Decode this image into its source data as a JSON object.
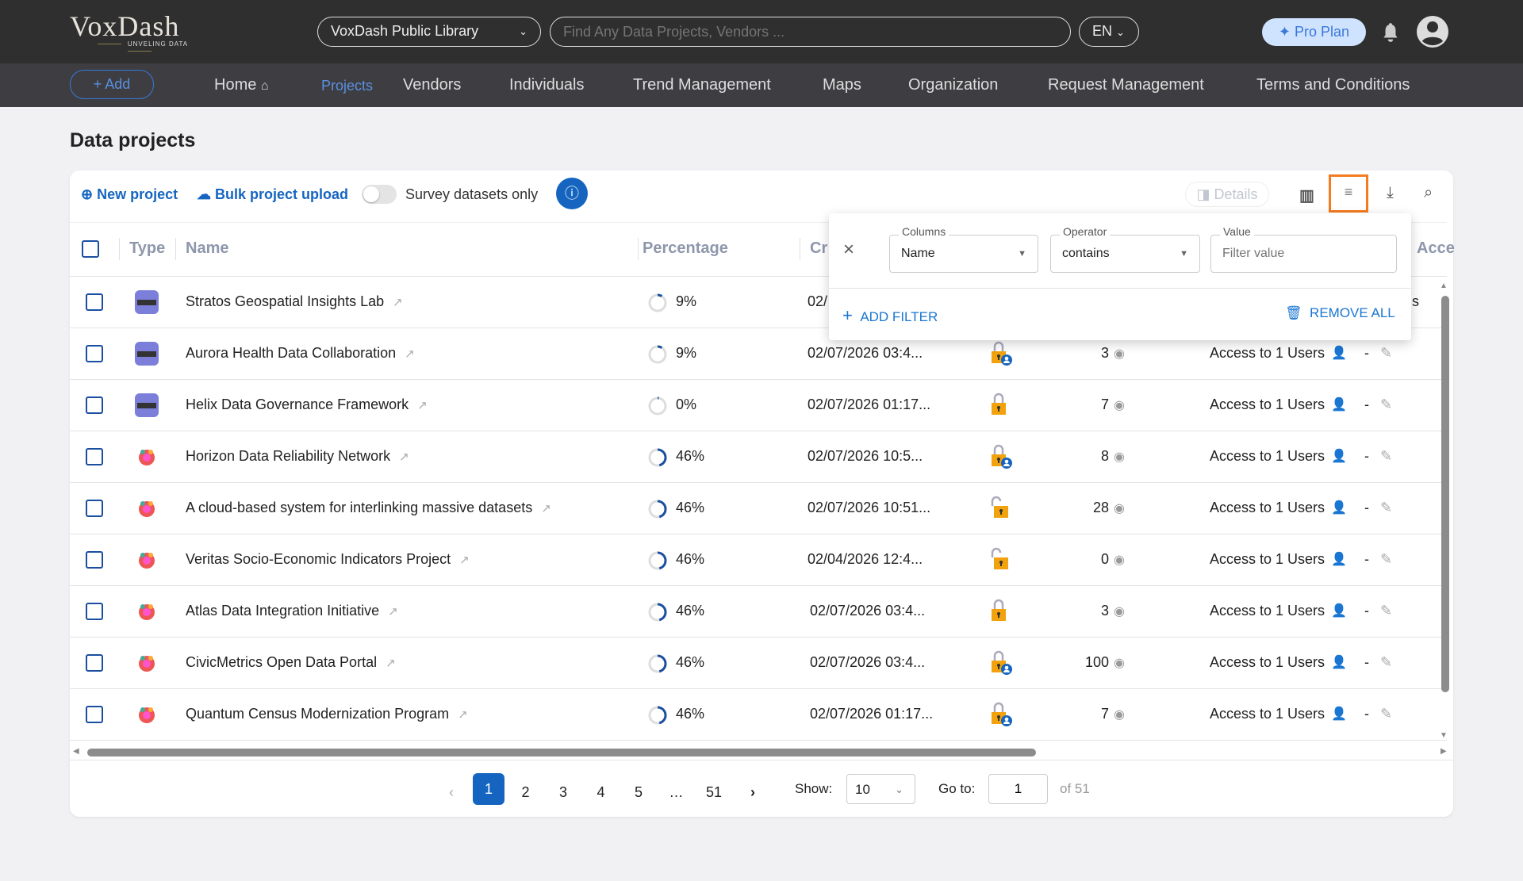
{
  "header": {
    "logo": "VoxDash",
    "tagline": "UNVELING DATA",
    "library": "VoxDash Public Library",
    "search_placeholder": "Find Any Data Projects, Vendors ...",
    "language": "EN",
    "plan": "Pro Plan"
  },
  "nav": {
    "add": "Add",
    "items": [
      "Home",
      "Projects",
      "Vendors",
      "Individuals",
      "Trend Management",
      "Maps",
      "Organization",
      "Request Management",
      "Terms and Conditions"
    ],
    "active": "Projects"
  },
  "page": {
    "title": "Data projects"
  },
  "toolbar": {
    "new_project": "New project",
    "bulk_upload": "Bulk project upload",
    "survey_only": "Survey datasets only",
    "details": "Details"
  },
  "table": {
    "headers": {
      "type": "Type",
      "name": "Name",
      "percentage": "Percentage",
      "created": "Cr",
      "access": "Acce"
    },
    "rows": [
      {
        "type": "dataset",
        "name": "Stratos Geospatial Insights Lab",
        "pct": "9%",
        "p": 9,
        "created": "02/",
        "lock": "locked-user",
        "views": "",
        "access": "s"
      },
      {
        "type": "dataset",
        "name": "Aurora Health Data Collaboration",
        "pct": "9%",
        "p": 9,
        "created": "02/07/2026 03:4...",
        "lock": "locked-user",
        "views": "3",
        "access": "Access to 1 Users"
      },
      {
        "type": "dataset",
        "name": "Helix Data Governance Framework",
        "pct": "0%",
        "p": 0,
        "created": "02/07/2026 01:17...",
        "lock": "locked",
        "views": "7",
        "access": "Access to 1 Users"
      },
      {
        "type": "survey",
        "name": "Horizon Data Reliability Network",
        "pct": "46%",
        "p": 46,
        "created": "02/07/2026 10:5...",
        "lock": "locked-user",
        "views": "8",
        "access": "Access to 1 Users"
      },
      {
        "type": "survey",
        "name": "A cloud-based system for interlinking massive datasets",
        "pct": "46%",
        "p": 46,
        "created": "02/07/2026 10:51...",
        "lock": "unlocked",
        "views": "28",
        "access": "Access to 1 Users"
      },
      {
        "type": "survey",
        "name": "Veritas Socio-Economic Indicators Project",
        "pct": "46%",
        "p": 46,
        "created": "02/04/2026 12:4...",
        "lock": "unlocked",
        "views": "0",
        "access": "Access to 1 Users"
      },
      {
        "type": "survey",
        "name": "Atlas Data Integration Initiative",
        "pct": "46%",
        "p": 46,
        "created": "02/07/2026 03:4...",
        "lock": "locked",
        "views": "3",
        "access": "Access to 1 Users"
      },
      {
        "type": "survey",
        "name": "CivicMetrics Open Data Portal",
        "pct": "46%",
        "p": 46,
        "created": "02/07/2026 03:4...",
        "lock": "locked-user",
        "views": "100",
        "access": "Access to 1 Users"
      },
      {
        "type": "survey",
        "name": "Quantum Census Modernization Program",
        "pct": "46%",
        "p": 46,
        "created": "02/07/2026 01:17...",
        "lock": "locked-user",
        "views": "7",
        "access": "Access to 1 Users"
      }
    ],
    "dash": "-"
  },
  "filter": {
    "columns_label": "Columns",
    "columns_value": "Name",
    "operator_label": "Operator",
    "operator_value": "contains",
    "value_label": "Value",
    "value_placeholder": "Filter value",
    "add": "ADD FILTER",
    "remove": "REMOVE ALL"
  },
  "pagination": {
    "pages": [
      "1",
      "2",
      "3",
      "4",
      "5",
      "…",
      "51"
    ],
    "current": "1",
    "show_label": "Show:",
    "show_value": "10",
    "goto_label": "Go to:",
    "goto_value": "1",
    "of": "of 51"
  }
}
